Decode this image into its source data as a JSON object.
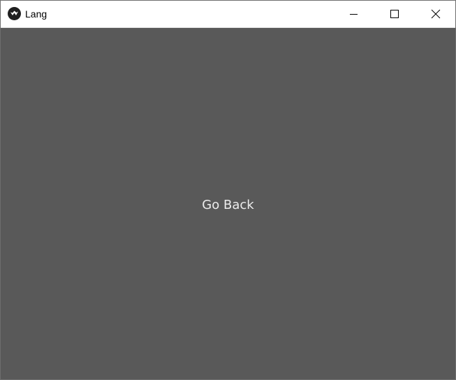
{
  "window": {
    "title": "Lang",
    "app_icon": "kivy-logo-icon",
    "controls": {
      "minimize_icon": "minimize-icon",
      "maximize_icon": "maximize-icon",
      "close_icon": "close-icon"
    }
  },
  "main": {
    "button_label": "Go Back"
  },
  "colors": {
    "titlebar": "#ffffff",
    "content_background": "#595959",
    "button_text": "#ececec"
  }
}
